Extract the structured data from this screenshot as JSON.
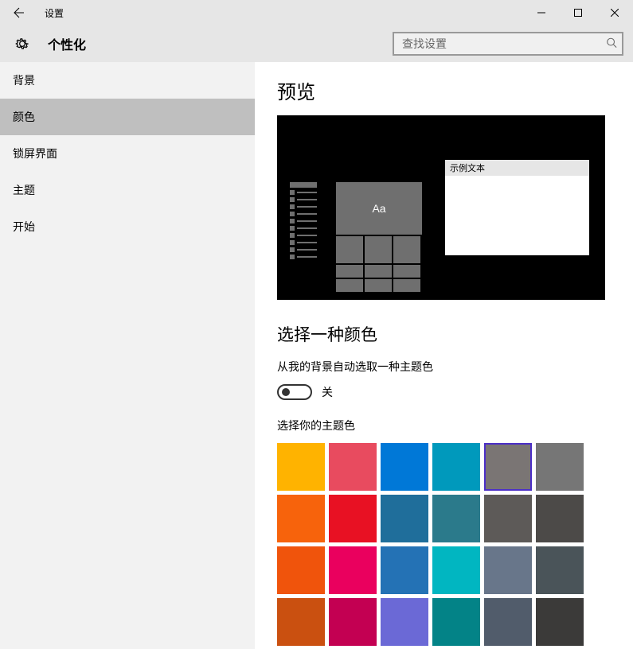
{
  "titlebar": {
    "title": "设置"
  },
  "header": {
    "page_title": "个性化",
    "search_placeholder": "查找设置"
  },
  "sidebar": {
    "items": [
      {
        "label": "背景"
      },
      {
        "label": "颜色"
      },
      {
        "label": "锁屏界面"
      },
      {
        "label": "主题"
      },
      {
        "label": "开始"
      }
    ],
    "active_index": 1
  },
  "content": {
    "preview_heading": "预览",
    "preview_tile_text": "Aa",
    "preview_window_title": "示例文本",
    "section_heading": "选择一种颜色",
    "auto_color_label": "从我的背景自动选取一种主题色",
    "toggle_label": "关",
    "pick_color_label": "选择你的主题色",
    "colors": [
      "#ffb300",
      "#e84b5f",
      "#0078d7",
      "#0099bc",
      "#7a7574",
      "#767676",
      "#f7630c",
      "#e81123",
      "#1f6e9b",
      "#2b7a8b",
      "#5d5a58",
      "#4c4a48",
      "#f0540c",
      "#ea005e",
      "#2472b5",
      "#01b6c1",
      "#68768a",
      "#4a5459",
      "#ca5010",
      "#c30052",
      "#6b69d6",
      "#038387",
      "#515c6b",
      "#3b3a39"
    ],
    "selected_index": 4
  }
}
